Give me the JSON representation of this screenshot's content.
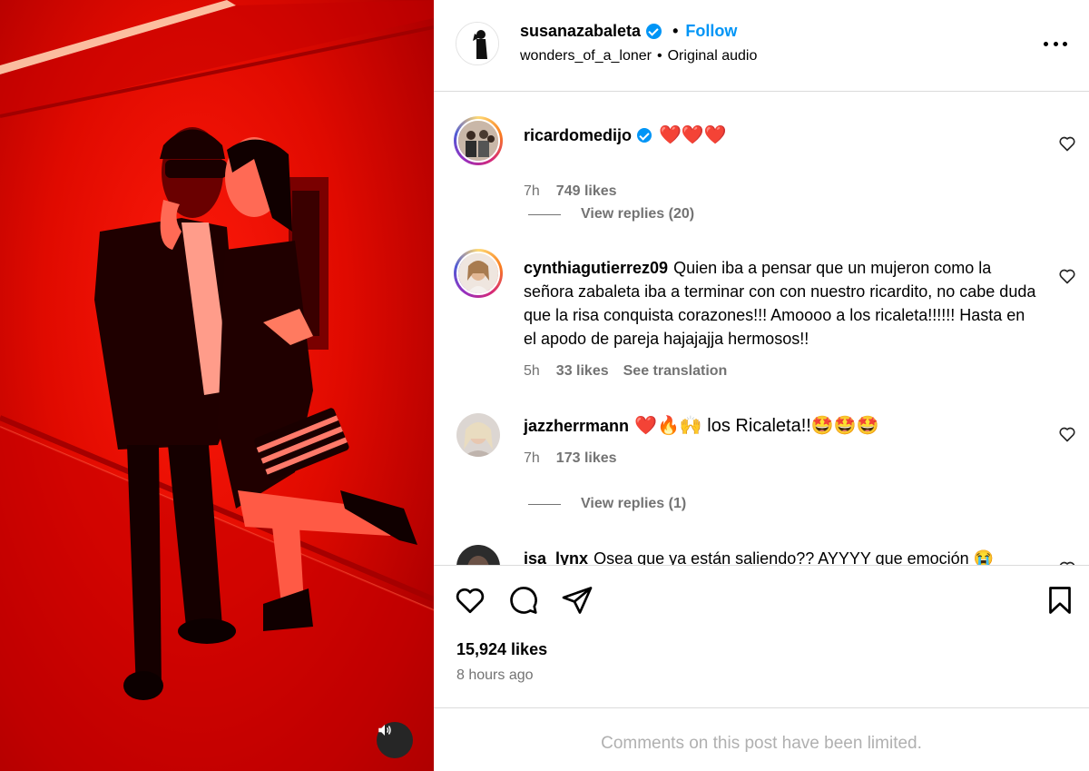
{
  "post": {
    "author": "susanazabaleta",
    "follow_label": "Follow",
    "separator": "•",
    "audio_user": "wonders_of_a_loner",
    "audio_label": "Original audio"
  },
  "comments": [
    {
      "user": "ricardomedijo",
      "verified": true,
      "text": "❤️❤️❤️",
      "time": "7h",
      "likes": "749 likes",
      "replies": "View replies (20)"
    },
    {
      "user": "cynthiagutierrez09",
      "verified": false,
      "text": "Quien iba a pensar que un mujeron como la señora zabaleta iba a terminar con con nuestro ricardito, no cabe duda que la risa conquista corazones!!! Amoooo a los ricaleta!!!!!! Hasta en el apodo de pareja hajajajja hermosos!!",
      "time": "5h",
      "likes": "33 likes",
      "translation": "See translation"
    },
    {
      "user": "jazzherrmann",
      "verified": false,
      "text": "❤️🔥🙌 los Ricaleta!!🤩🤩🤩",
      "time": "7h",
      "likes": "173 likes",
      "replies": "View replies (1)"
    },
    {
      "user": "isa_lynx",
      "verified": false,
      "text": "Osea que ya están saliendo?? AYYYY que emoción 😭"
    }
  ],
  "stats": {
    "likes": "15,924 likes",
    "time_ago": "8 hours ago"
  },
  "footer": {
    "limited_text": "Comments on this post have been limited."
  },
  "icons": {
    "like": "heart-icon",
    "comment": "comment-icon",
    "share": "paper-plane-icon",
    "save": "bookmark-icon",
    "sound": "speaker-icon",
    "more": "more-options-icon"
  },
  "colors": {
    "link_blue": "#0095f6",
    "muted_text": "#737373",
    "border": "#dbdbdb",
    "media_red": "#e00a00"
  }
}
